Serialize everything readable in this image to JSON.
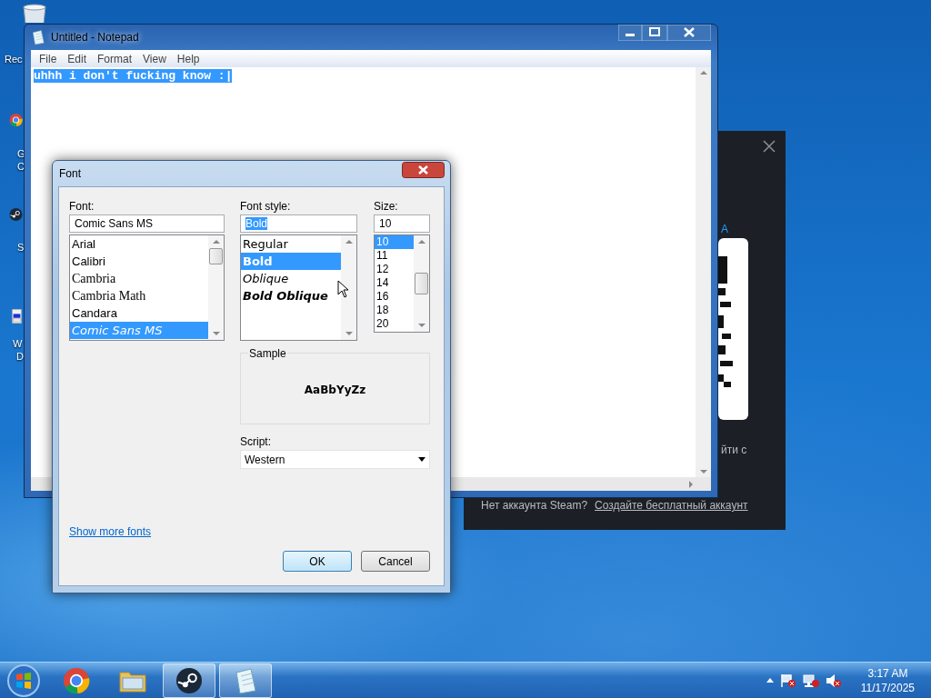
{
  "desktop_icons": [
    {
      "kind": "bin",
      "label_lines": [
        "Rec"
      ]
    },
    {
      "kind": "chrome",
      "label_lines": [
        "G",
        "C"
      ]
    },
    {
      "kind": "steam",
      "label_lines": [
        "S"
      ]
    },
    {
      "kind": "disk",
      "label_lines": [
        "W",
        "D"
      ]
    }
  ],
  "steam_window": {
    "heading_fragment": "А",
    "qr_caption_fragment": "йти с",
    "no_account": "Нет аккаунта Steam?",
    "create_account_link": "Создайте бесплатный аккаунт"
  },
  "notepad": {
    "title": "Untitled - Notepad",
    "menu": [
      "File",
      "Edit",
      "Format",
      "View",
      "Help"
    ],
    "text": "uhhh i don't fucking know :|",
    "text_selected": true
  },
  "font_dialog": {
    "title": "Font",
    "font": {
      "label": "Font:",
      "value": "Comic Sans MS",
      "items": [
        {
          "label": "Arial",
          "kind": "sans",
          "selected": false
        },
        {
          "label": "Calibri",
          "kind": "sans",
          "selected": false
        },
        {
          "label": "Cambria",
          "kind": "serif",
          "selected": false
        },
        {
          "label": "Cambria Math",
          "kind": "serif",
          "selected": false
        },
        {
          "label": "Candara",
          "kind": "sans",
          "selected": false
        },
        {
          "label": "Comic Sans MS",
          "kind": "comic",
          "selected": true
        }
      ]
    },
    "style": {
      "label": "Font style:",
      "value": "Bold",
      "value_selected": true,
      "items": [
        {
          "label": "Regular",
          "kind": "regular",
          "selected": false
        },
        {
          "label": "Bold",
          "kind": "bold",
          "selected": true
        },
        {
          "label": "Oblique",
          "kind": "oblique",
          "selected": false
        },
        {
          "label": "Bold Oblique",
          "kind": "bold-oblique",
          "selected": false
        }
      ]
    },
    "size": {
      "label": "Size:",
      "value": "10",
      "items": [
        {
          "label": "10",
          "selected": true
        },
        {
          "label": "11",
          "selected": false
        },
        {
          "label": "12",
          "selected": false
        },
        {
          "label": "14",
          "selected": false
        },
        {
          "label": "16",
          "selected": false
        },
        {
          "label": "18",
          "selected": false
        },
        {
          "label": "20",
          "selected": false
        }
      ]
    },
    "sample": {
      "label": "Sample",
      "text": "AaBbYyZz"
    },
    "script": {
      "label": "Script:",
      "value": "Western"
    },
    "link": "Show more fonts",
    "buttons": [
      {
        "label": "OK",
        "default": true
      },
      {
        "label": "Cancel",
        "default": false
      }
    ]
  },
  "taskbar": {
    "apps": [
      {
        "kind": "chrome",
        "running": false
      },
      {
        "kind": "explorer",
        "running": false
      },
      {
        "kind": "steam",
        "running": true
      },
      {
        "kind": "notepad",
        "running": true
      }
    ],
    "clock": {
      "time": "3:17 AM",
      "date": "11/17/2025"
    }
  }
}
